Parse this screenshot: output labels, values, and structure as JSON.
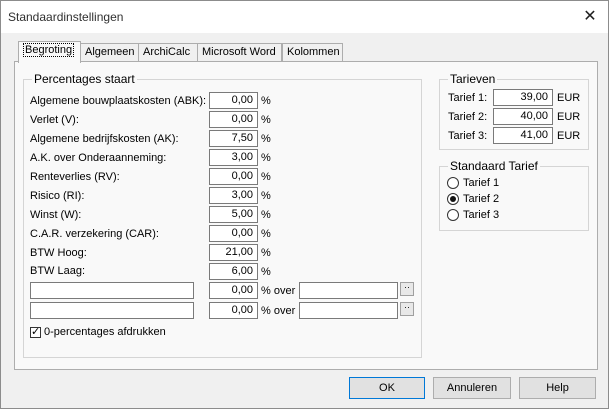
{
  "window": {
    "title": "Standaardinstellingen",
    "close_icon": "close-icon"
  },
  "tabs": [
    "Begroting",
    "Algemeen",
    "ArchiCalc",
    "Microsoft Word",
    "Kolommen"
  ],
  "percentages": {
    "title": "Percentages staart",
    "rows": [
      {
        "label": "Algemene  bouwplaatskosten (ABK):",
        "value": "0,00",
        "unit": "%"
      },
      {
        "label": "Verlet (V):",
        "value": "0,00",
        "unit": "%"
      },
      {
        "label": "Algemene bedrijfskosten (AK):",
        "value": "7,50",
        "unit": "%"
      },
      {
        "label": "A.K. over Onderaanneming:",
        "value": "3,00",
        "unit": "%"
      },
      {
        "label": "Renteverlies (RV):",
        "value": "0,00",
        "unit": "%"
      },
      {
        "label": "Risico (RI):",
        "value": "3,00",
        "unit": "%"
      },
      {
        "label": "Winst (W):",
        "value": "5,00",
        "unit": "%"
      },
      {
        "label": "C.A.R. verzekering (CAR):",
        "value": "0,00",
        "unit": "%"
      },
      {
        "label": "BTW Hoog:",
        "value": "21,00",
        "unit": "%"
      },
      {
        "label": "BTW Laag:",
        "value": "6,00",
        "unit": "%"
      }
    ],
    "custom": [
      {
        "name": "",
        "value": "0,00",
        "unit": "% over",
        "over": "",
        "pick": "··"
      },
      {
        "name": "",
        "value": "0,00",
        "unit": "% over",
        "over": "",
        "pick": "··"
      }
    ],
    "print_zero": {
      "label": "0-percentages afdrukken",
      "checked": true,
      "mark": "✓"
    }
  },
  "tarieven": {
    "title": "Tarieven",
    "rows": [
      {
        "label": "Tarief 1:",
        "value": "39,00",
        "unit": "EUR"
      },
      {
        "label": "Tarief 2:",
        "value": "40,00",
        "unit": "EUR"
      },
      {
        "label": "Tarief 3:",
        "value": "41,00",
        "unit": "EUR"
      }
    ]
  },
  "standaard_tarief": {
    "title": "Standaard Tarief",
    "options": [
      "Tarief 1",
      "Tarief 2",
      "Tarief 3"
    ],
    "selected": "Tarief 2"
  },
  "buttons": {
    "ok": "OK",
    "cancel": "Annuleren",
    "help": "Help"
  },
  "colors": {
    "dialog_bg": "#f0f0f0",
    "panel_bg": "#f9f9f9",
    "default_button_border": "#0078d7"
  }
}
